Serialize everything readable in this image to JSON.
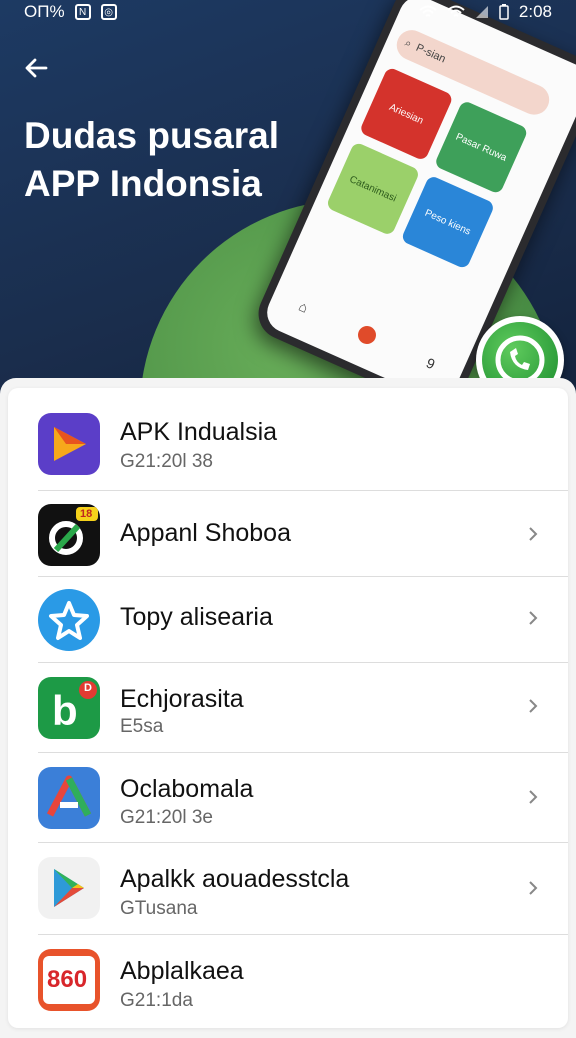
{
  "status": {
    "left_text": "ОП%",
    "time": "2:08"
  },
  "header": {
    "title_line1": "Dudas pusaral",
    "title_line2": "APP Indonsia"
  },
  "phone": {
    "search_text": "P-sian",
    "tile1": "Ariesian",
    "tile2": "Pasar Ruwa",
    "tile3": "Catanimasi",
    "tile4": "Peso kiens",
    "nav_item": "9"
  },
  "apps": [
    {
      "name": "APK Indualsia",
      "sub": "G21:20l 38",
      "chevron": false
    },
    {
      "name": "Appanl Shoboa",
      "sub": "",
      "chevron": true
    },
    {
      "name": "Topy alisearia",
      "sub": "",
      "chevron": true
    },
    {
      "name": "Echjorasita",
      "sub": "E5sa",
      "chevron": true
    },
    {
      "name": "Oclabomala",
      "sub": "G21:20l 3e",
      "chevron": true
    },
    {
      "name": "Apalkk aouadesstcla",
      "sub": "GTusana",
      "chevron": true
    },
    {
      "name": "Abplalkaea",
      "sub": "G21:1da",
      "chevron": false
    }
  ],
  "icons": {
    "app1": "triangle-play-icon",
    "app2": "black-target-icon",
    "app3": "star-icon",
    "app4": "b-icon",
    "app5": "arrow-a-icon",
    "app6": "play-store-icon",
    "app7": "860-icon",
    "app7_text": "860",
    "app2_badge": "18",
    "app4_badge": "D"
  },
  "colors": {
    "accent": "#2e9e3b",
    "header_bg": "#1d3a63"
  }
}
